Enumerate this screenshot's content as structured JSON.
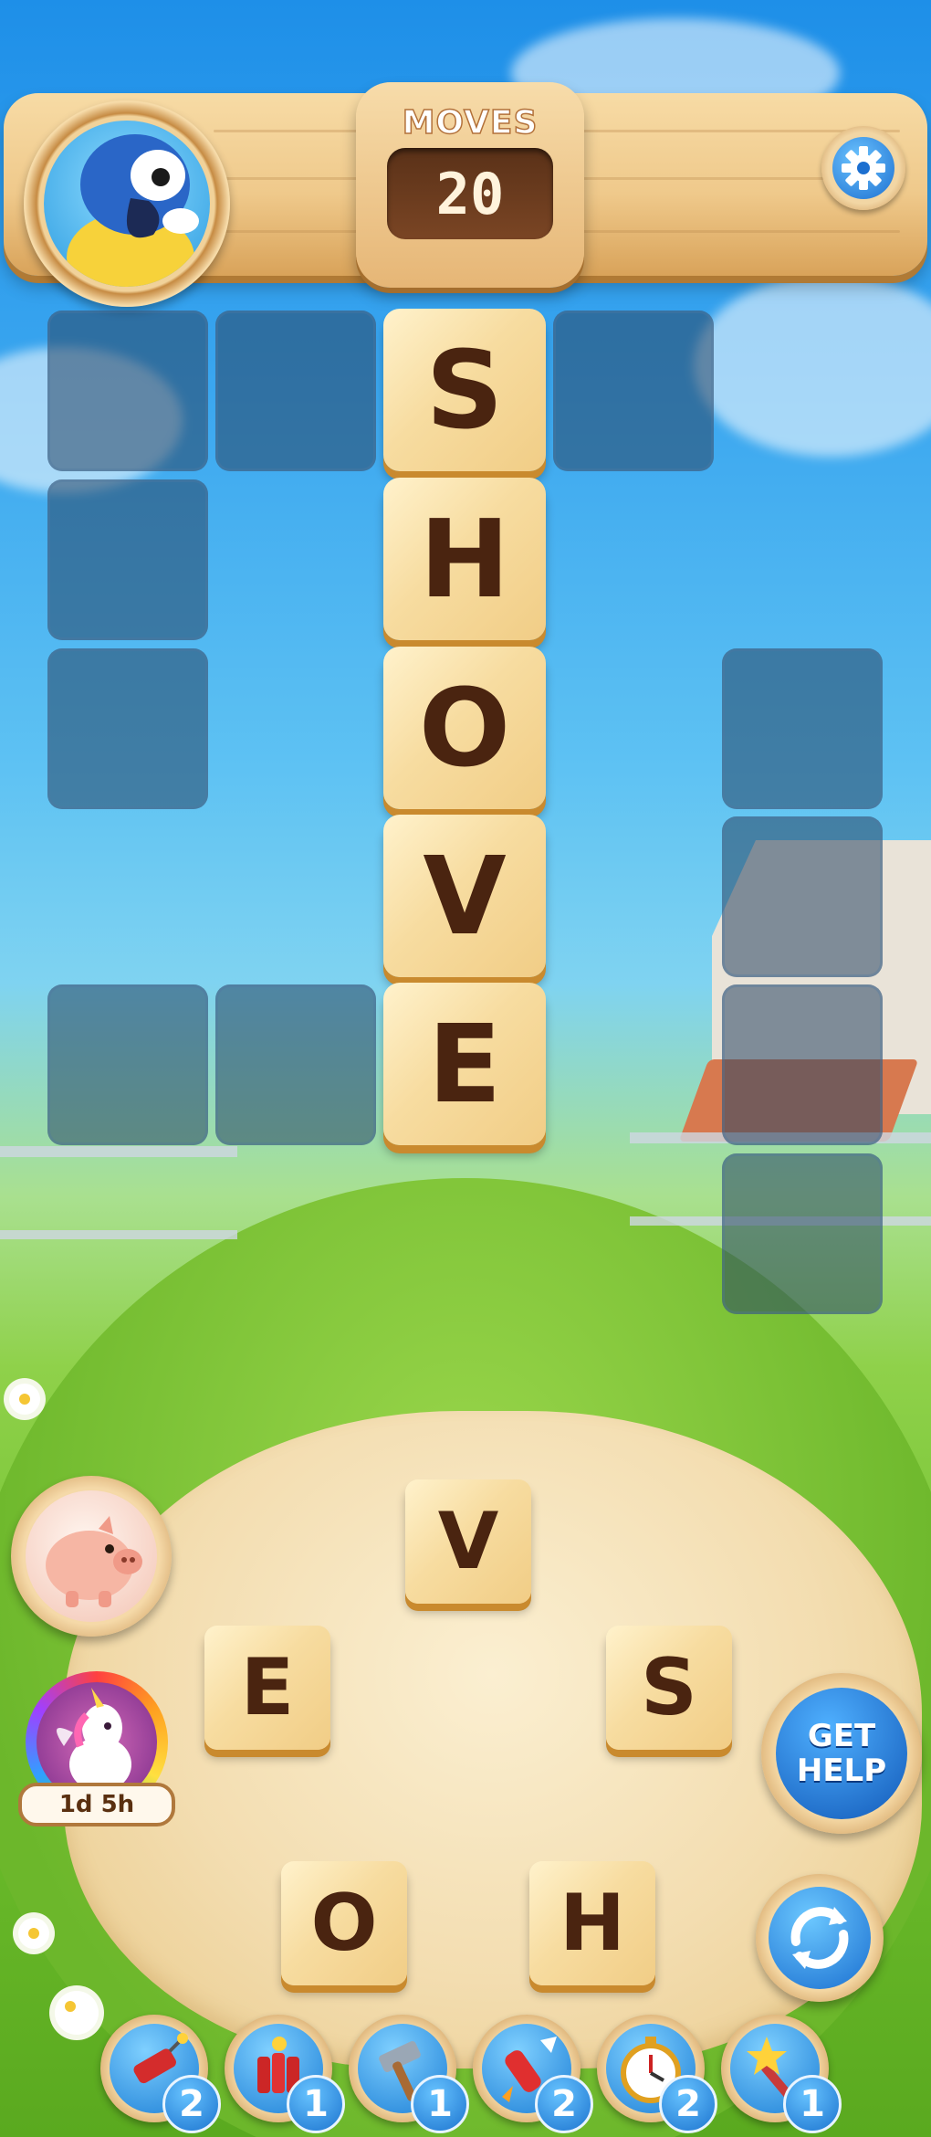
{
  "header": {
    "moves_label": "MOVES",
    "moves_value": "20"
  },
  "board": {
    "solved_word": "SHOVE",
    "tiles": [
      "S",
      "H",
      "O",
      "V",
      "E"
    ]
  },
  "wheel": {
    "letters": [
      "V",
      "E",
      "S",
      "O",
      "H"
    ]
  },
  "event": {
    "timer": "1d 5h"
  },
  "buttons": {
    "get_help_line1": "GET",
    "get_help_line2": "HELP"
  },
  "boosters": [
    {
      "icon": "dynamite-icon",
      "count": "2"
    },
    {
      "icon": "tnt-bundle-icon",
      "count": "1"
    },
    {
      "icon": "hammer-icon",
      "count": "1"
    },
    {
      "icon": "rocket-icon",
      "count": "2"
    },
    {
      "icon": "stopwatch-icon",
      "count": "2"
    },
    {
      "icon": "magic-wand-icon",
      "count": "1"
    }
  ],
  "colors": {
    "tile_face": "#f7dca0",
    "letter": "#4a2410",
    "empty_cell": "#4a6a8a"
  }
}
